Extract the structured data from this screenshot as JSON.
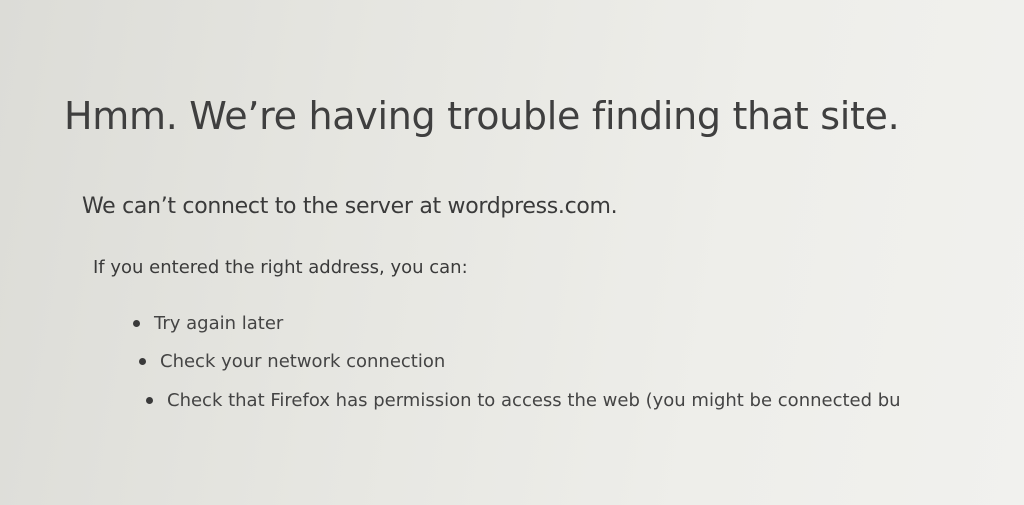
{
  "error_page": {
    "title": "Hmm. We’re having trouble finding that site.",
    "subtitle": "We can’t connect to the server at wordpress.com.",
    "intro": "If you entered the right address, you can:",
    "suggestions": [
      "Try again later",
      "Check your network connection",
      "Check that Firefox has permission to access the web (you might be connected bu"
    ]
  }
}
